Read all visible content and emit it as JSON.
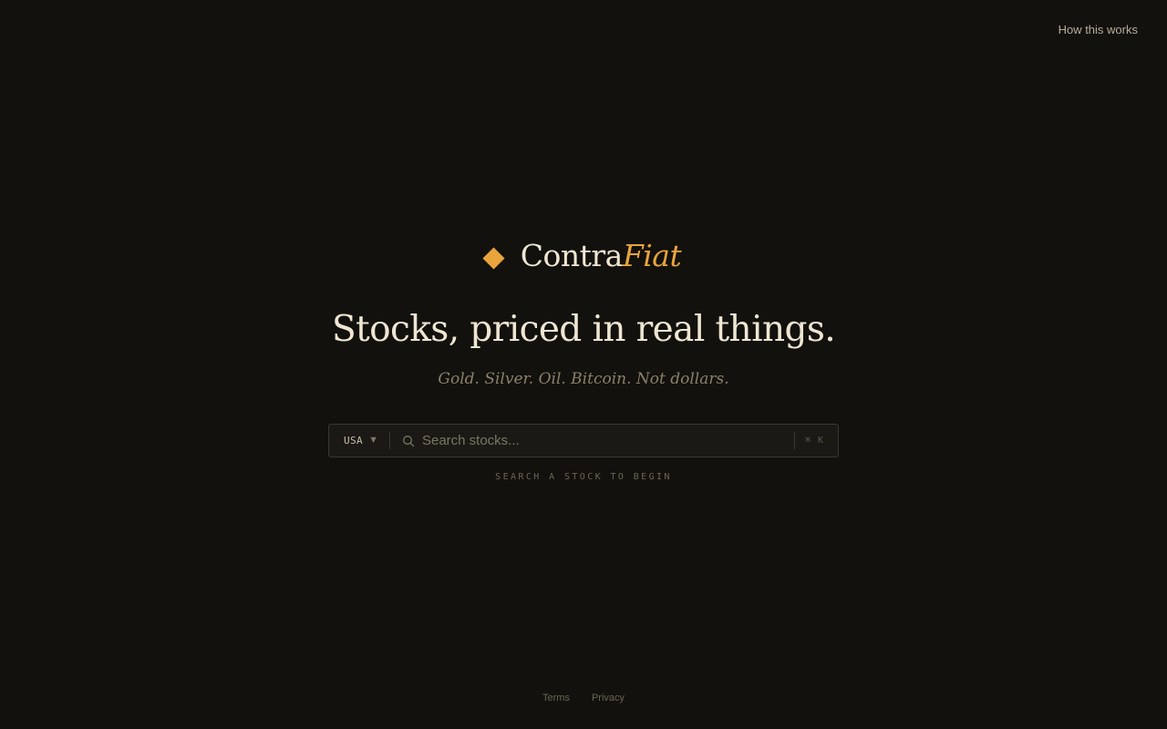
{
  "header": {
    "how_it_works_label": "How this works"
  },
  "brand": {
    "name_main": "Contra",
    "name_accent": "Fiat",
    "logo_icon": "diamond-icon",
    "accent_color": "#e9a43c"
  },
  "hero": {
    "headline": "Stocks, priced in real things.",
    "subhead": "Gold. Silver. Oil. Bitcoin. Not dollars."
  },
  "search": {
    "country_selected": "USA",
    "caret_glyph": "▼",
    "search_icon": "search-icon",
    "placeholder": "Search stocks...",
    "value": "",
    "shortcut": "⌘ K",
    "hint": "SEARCH A STOCK TO BEGIN"
  },
  "footer": {
    "terms_label": "Terms",
    "privacy_label": "Privacy"
  }
}
